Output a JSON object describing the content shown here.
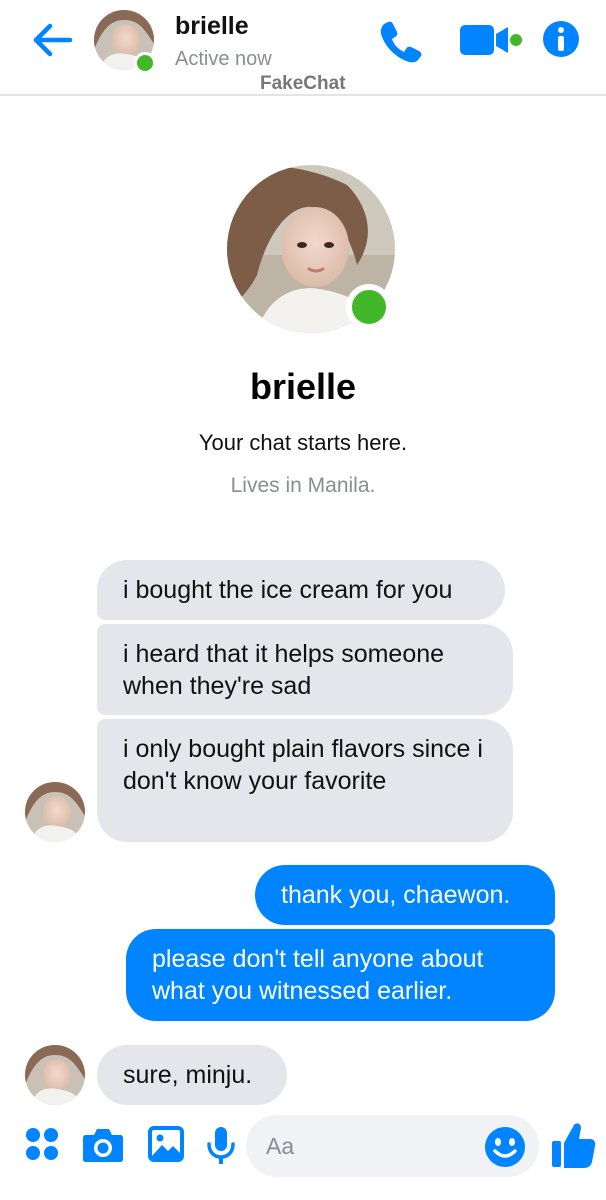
{
  "header": {
    "name": "brielle",
    "status": "Active now",
    "watermark": "FakeChat"
  },
  "intro": {
    "name": "brielle",
    "subtitle": "Your chat starts here.",
    "location": "Lives in Manila."
  },
  "messages": [
    {
      "from": "them",
      "text": "i bought the ice cream for you"
    },
    {
      "from": "them",
      "text": "i heard that it helps someone when they're sad"
    },
    {
      "from": "them",
      "text": "i only bought plain flavors since i don't know your favorite"
    },
    {
      "from": "me",
      "text": "thank you, chaewon."
    },
    {
      "from": "me",
      "text": "please don't tell anyone about what you witnessed earlier."
    },
    {
      "from": "them",
      "text": "sure, minju."
    }
  ],
  "composer": {
    "placeholder": "Aa"
  },
  "icons": {
    "back": "back-arrow-icon",
    "call": "phone-icon",
    "video": "video-camera-icon",
    "info": "info-icon",
    "apps": "apps-grid-icon",
    "camera": "camera-icon",
    "gallery": "image-icon",
    "mic": "microphone-icon",
    "emoji": "emoji-icon",
    "like": "thumbs-up-icon"
  },
  "colors": {
    "accent": "#0084ff",
    "incoming_bubble": "#e4e6eb",
    "online": "#42b72a"
  }
}
